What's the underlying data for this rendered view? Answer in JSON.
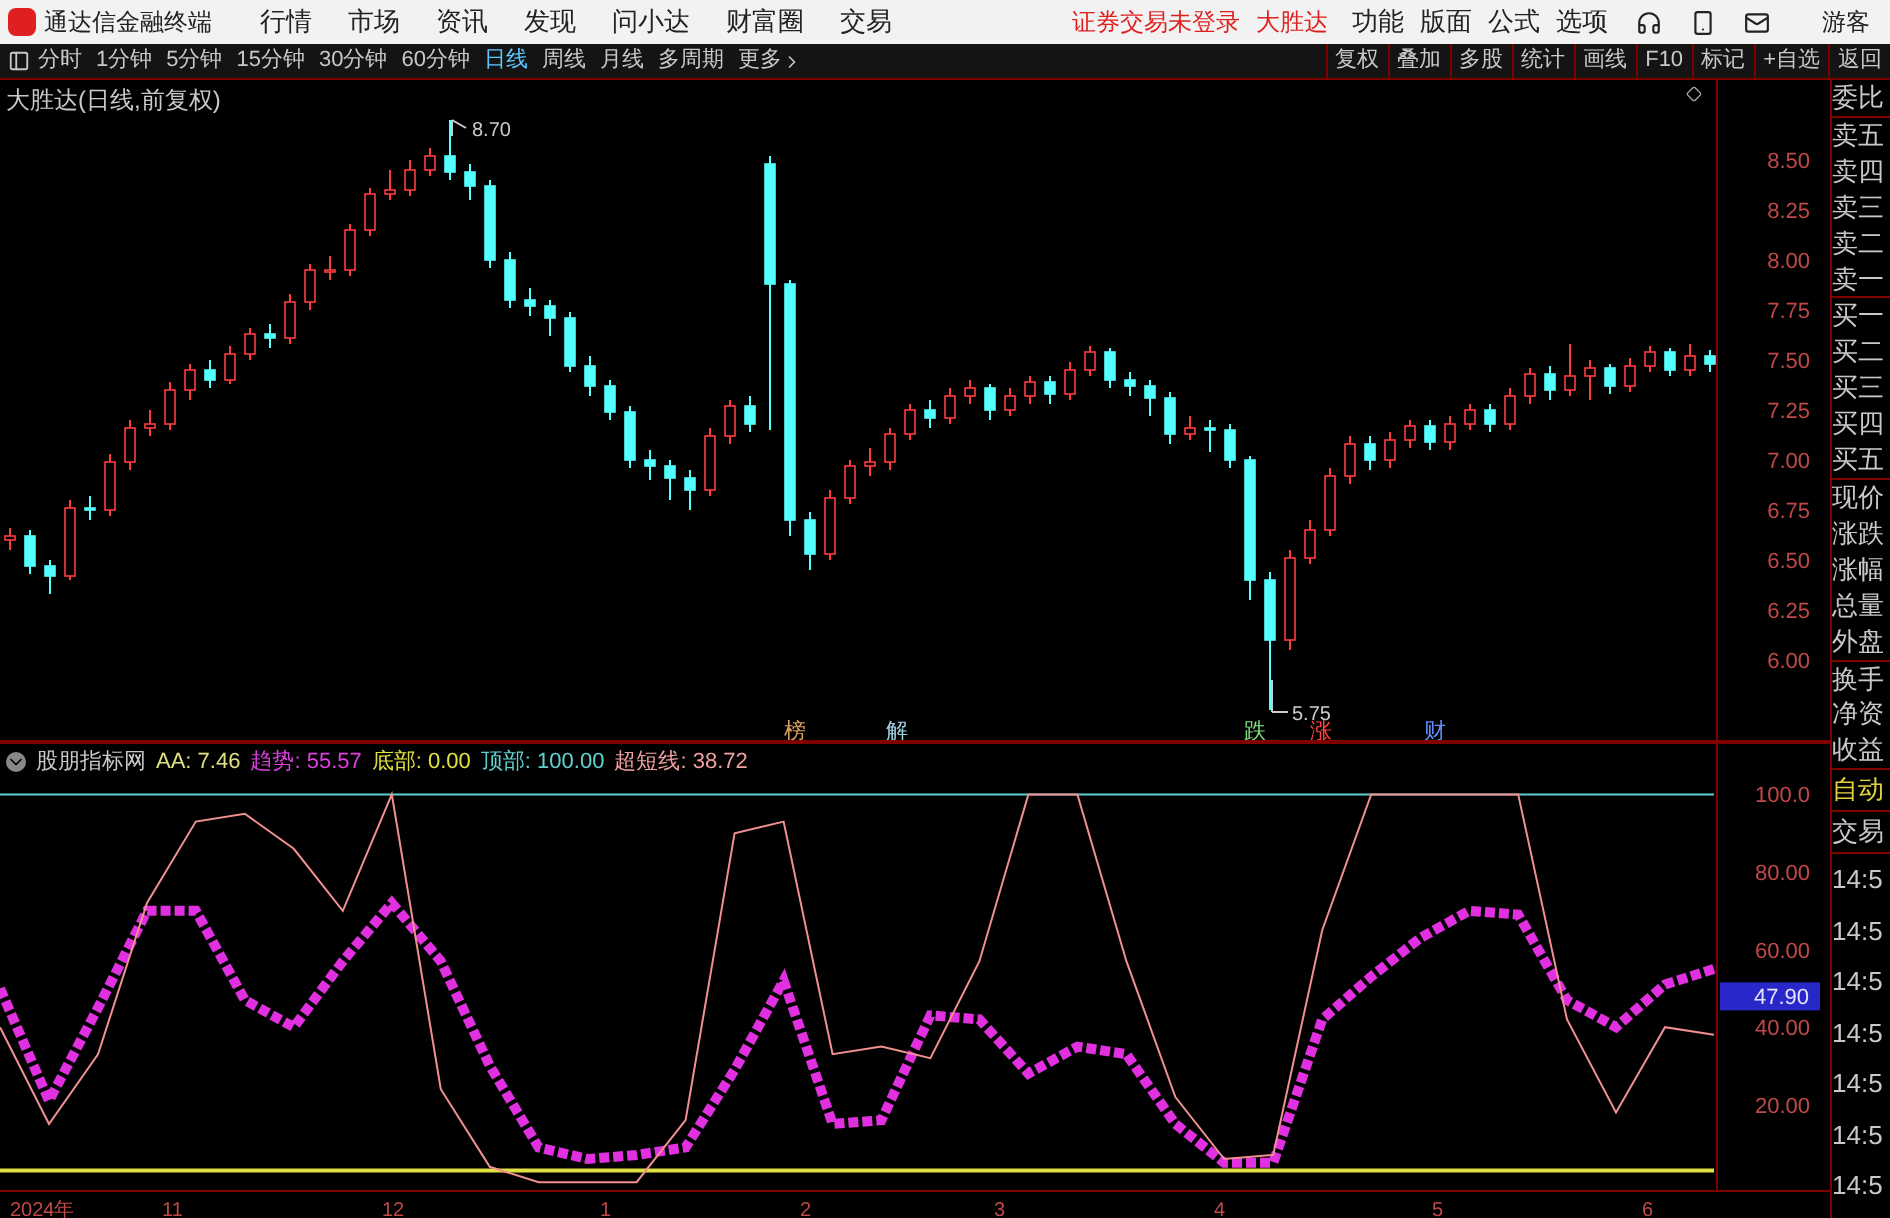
{
  "app": {
    "title": "通达信金融终端"
  },
  "menu": [
    "行情",
    "市场",
    "资讯",
    "发现",
    "问小达",
    "财富圈",
    "交易"
  ],
  "notices": [
    "证券交易未登录",
    "大胜达"
  ],
  "tools": [
    "功能",
    "版面",
    "公式",
    "选项"
  ],
  "user": "游客",
  "periods": [
    {
      "label": "分时",
      "selected": false
    },
    {
      "label": "1分钟",
      "selected": false
    },
    {
      "label": "5分钟",
      "selected": false
    },
    {
      "label": "15分钟",
      "selected": false
    },
    {
      "label": "30分钟",
      "selected": false
    },
    {
      "label": "60分钟",
      "selected": false
    },
    {
      "label": "日线",
      "selected": true
    },
    {
      "label": "周线",
      "selected": false
    },
    {
      "label": "月线",
      "selected": false
    },
    {
      "label": "多周期",
      "selected": false
    },
    {
      "label": "更多",
      "selected": false
    }
  ],
  "actions": [
    "复权",
    "叠加",
    "多股",
    "统计",
    "画线",
    "F10",
    "标记",
    "+自选",
    "返回"
  ],
  "chart": {
    "title": "大胜达(日线,前复权)",
    "high_label": "8.70",
    "low_label": "5.75",
    "chart_data": {
      "type": "candlestick",
      "ylim": [
        5.6,
        8.9
      ],
      "yticks": [
        {
          "value": 8.5,
          "label": "8.50"
        },
        {
          "value": 8.25,
          "label": "8.25"
        },
        {
          "value": 8,
          "label": "8.00"
        },
        {
          "value": 7.75,
          "label": "7.75"
        },
        {
          "value": 7.5,
          "label": "7.50"
        },
        {
          "value": 7.25,
          "label": "7.25"
        },
        {
          "value": 7,
          "label": "7.00"
        },
        {
          "value": 6.75,
          "label": "6.75"
        },
        {
          "value": 6.5,
          "label": "6.50"
        },
        {
          "value": 6.25,
          "label": "6.25"
        },
        {
          "value": 6,
          "label": "6.00"
        }
      ],
      "ohlc": [
        [
          6.6,
          6.66,
          6.55,
          6.62
        ],
        [
          6.62,
          6.65,
          6.43,
          6.47
        ],
        [
          6.47,
          6.5,
          6.33,
          6.42
        ],
        [
          6.42,
          6.8,
          6.4,
          6.76
        ],
        [
          6.76,
          6.82,
          6.7,
          6.75
        ],
        [
          6.75,
          7.03,
          6.72,
          6.99
        ],
        [
          6.99,
          7.2,
          6.95,
          7.16
        ],
        [
          7.16,
          7.25,
          7.12,
          7.18
        ],
        [
          7.18,
          7.39,
          7.15,
          7.35
        ],
        [
          7.35,
          7.48,
          7.3,
          7.45
        ],
        [
          7.45,
          7.5,
          7.36,
          7.4
        ],
        [
          7.4,
          7.57,
          7.38,
          7.53
        ],
        [
          7.53,
          7.66,
          7.5,
          7.63
        ],
        [
          7.63,
          7.68,
          7.56,
          7.61
        ],
        [
          7.61,
          7.83,
          7.58,
          7.79
        ],
        [
          7.79,
          7.98,
          7.75,
          7.95
        ],
        [
          7.95,
          8.02,
          7.9,
          7.95
        ],
        [
          7.95,
          8.18,
          7.92,
          8.15
        ],
        [
          8.15,
          8.36,
          8.12,
          8.33
        ],
        [
          8.33,
          8.45,
          8.3,
          8.35
        ],
        [
          8.35,
          8.5,
          8.32,
          8.45
        ],
        [
          8.45,
          8.56,
          8.42,
          8.52
        ],
        [
          8.52,
          8.7,
          8.4,
          8.44
        ],
        [
          8.44,
          8.48,
          8.3,
          8.37
        ],
        [
          8.37,
          8.4,
          7.96,
          8.0
        ],
        [
          8.0,
          8.04,
          7.76,
          7.8
        ],
        [
          7.8,
          7.86,
          7.72,
          7.77
        ],
        [
          7.77,
          7.8,
          7.62,
          7.71
        ],
        [
          7.71,
          7.74,
          7.44,
          7.47
        ],
        [
          7.47,
          7.52,
          7.32,
          7.37
        ],
        [
          7.37,
          7.4,
          7.2,
          7.24
        ],
        [
          7.24,
          7.27,
          6.96,
          7.0
        ],
        [
          7.0,
          7.05,
          6.9,
          6.97
        ],
        [
          6.97,
          7.0,
          6.8,
          6.91
        ],
        [
          6.91,
          6.95,
          6.75,
          6.85
        ],
        [
          6.85,
          7.16,
          6.82,
          7.12
        ],
        [
          7.12,
          7.3,
          7.08,
          7.27
        ],
        [
          7.27,
          7.32,
          7.14,
          7.18
        ],
        [
          8.48,
          8.52,
          7.15,
          7.88
        ],
        [
          7.88,
          7.9,
          6.62,
          6.7
        ],
        [
          6.7,
          6.74,
          6.45,
          6.53
        ],
        [
          6.53,
          6.85,
          6.5,
          6.81
        ],
        [
          6.81,
          7.0,
          6.78,
          6.97
        ],
        [
          6.97,
          7.06,
          6.92,
          6.99
        ],
        [
          6.99,
          7.16,
          6.95,
          7.13
        ],
        [
          7.13,
          7.28,
          7.1,
          7.25
        ],
        [
          7.25,
          7.3,
          7.16,
          7.21
        ],
        [
          7.21,
          7.36,
          7.18,
          7.32
        ],
        [
          7.32,
          7.4,
          7.28,
          7.36
        ],
        [
          7.36,
          7.38,
          7.2,
          7.25
        ],
        [
          7.25,
          7.36,
          7.22,
          7.32
        ],
        [
          7.32,
          7.42,
          7.28,
          7.39
        ],
        [
          7.39,
          7.42,
          7.28,
          7.33
        ],
        [
          7.33,
          7.49,
          7.3,
          7.45
        ],
        [
          7.45,
          7.57,
          7.42,
          7.54
        ],
        [
          7.54,
          7.56,
          7.36,
          7.4
        ],
        [
          7.4,
          7.44,
          7.32,
          7.37
        ],
        [
          7.37,
          7.4,
          7.22,
          7.31
        ],
        [
          7.31,
          7.34,
          7.08,
          7.13
        ],
        [
          7.13,
          7.22,
          7.1,
          7.16
        ],
        [
          7.16,
          7.2,
          7.04,
          7.15
        ],
        [
          7.15,
          7.18,
          6.96,
          7.0
        ],
        [
          7.0,
          7.02,
          6.3,
          6.4
        ],
        [
          6.4,
          6.44,
          5.75,
          6.1
        ],
        [
          6.1,
          6.55,
          6.05,
          6.51
        ],
        [
          6.51,
          6.7,
          6.48,
          6.65
        ],
        [
          6.65,
          6.96,
          6.62,
          6.92
        ],
        [
          6.92,
          7.12,
          6.88,
          7.08
        ],
        [
          7.08,
          7.12,
          6.95,
          7.0
        ],
        [
          7.0,
          7.14,
          6.96,
          7.1
        ],
        [
          7.1,
          7.2,
          7.06,
          7.17
        ],
        [
          7.17,
          7.2,
          7.05,
          7.09
        ],
        [
          7.09,
          7.22,
          7.05,
          7.18
        ],
        [
          7.18,
          7.28,
          7.15,
          7.25
        ],
        [
          7.25,
          7.28,
          7.14,
          7.18
        ],
        [
          7.18,
          7.36,
          7.15,
          7.32
        ],
        [
          7.32,
          7.46,
          7.28,
          7.43
        ],
        [
          7.43,
          7.47,
          7.3,
          7.35
        ],
        [
          7.35,
          7.58,
          7.32,
          7.42
        ],
        [
          7.42,
          7.5,
          7.3,
          7.46
        ],
        [
          7.46,
          7.48,
          7.33,
          7.37
        ],
        [
          7.37,
          7.51,
          7.34,
          7.47
        ],
        [
          7.47,
          7.57,
          7.44,
          7.54
        ],
        [
          7.54,
          7.56,
          7.42,
          7.45
        ],
        [
          7.45,
          7.58,
          7.42,
          7.52
        ],
        [
          7.52,
          7.55,
          7.44,
          7.48
        ]
      ]
    },
    "tags": [
      {
        "text": "榜",
        "color": "#e0a060"
      },
      {
        "text": "解",
        "color": "#a0d0e0"
      },
      {
        "text": "跌",
        "color": "#80e080"
      },
      {
        "text": "涨",
        "color": "#ff4040"
      },
      {
        "text": "财",
        "color": "#6090ff"
      }
    ]
  },
  "indicator": {
    "name": "股朋指标网",
    "values": [
      {
        "label": "AA:",
        "value": "7.46",
        "color": "#e0e080"
      },
      {
        "label": "趋势:",
        "value": "55.57",
        "color": "#e040e0"
      },
      {
        "label": "底部:",
        "value": "0.00",
        "color": "#e0e040"
      },
      {
        "label": "顶部:",
        "value": "100.00",
        "color": "#60d0d0"
      },
      {
        "label": "超短线:",
        "value": "38.72",
        "color": "#f0a0a0"
      }
    ],
    "chart_data": {
      "type": "line",
      "ylim": [
        -2,
        113
      ],
      "yticks": [
        {
          "value": 100,
          "label": "100.0"
        },
        {
          "value": 80,
          "label": "80.00"
        },
        {
          "value": 60,
          "label": "60.00"
        },
        {
          "value": 40,
          "label": "40.00"
        },
        {
          "value": 20,
          "label": "20.00"
        }
      ],
      "series": [
        {
          "color": "#f09090",
          "values": [
            40,
            15,
            33,
            72,
            93,
            95,
            86,
            70,
            100,
            24,
            4,
            0,
            0,
            0,
            16,
            90,
            93,
            33,
            35,
            32,
            57,
            100,
            100,
            57,
            22,
            6,
            7,
            65,
            100,
            100,
            100,
            100,
            42,
            18,
            40,
            38
          ]
        },
        {
          "color": "#e030e0",
          "line_style": "dashed",
          "values": [
            50,
            21,
            45,
            70,
            70,
            47,
            40,
            57,
            72,
            57,
            30,
            9,
            6,
            7,
            9,
            29,
            52,
            15,
            16,
            43,
            42,
            28,
            35,
            33,
            15,
            5,
            5,
            42,
            53,
            63,
            70,
            69,
            47,
            40,
            51,
            55
          ]
        },
        {
          "color": "#60d0d0",
          "values": [
            100,
            100,
            100,
            100,
            100,
            100,
            100,
            100,
            100,
            100,
            100,
            100,
            100,
            100,
            100,
            100,
            100,
            100,
            100,
            100,
            100,
            100,
            100,
            100,
            100,
            100,
            100,
            100,
            100,
            100,
            100,
            100,
            100,
            100,
            100,
            100
          ]
        },
        {
          "color": "#e0e040",
          "values": [
            3,
            3,
            3,
            3,
            3,
            3,
            3,
            3,
            3,
            3,
            3,
            3,
            3,
            3,
            3,
            3,
            3,
            3,
            3,
            3,
            3,
            3,
            3,
            3,
            3,
            3,
            3,
            3,
            3,
            3,
            3,
            3,
            3,
            3,
            3,
            3
          ]
        }
      ]
    },
    "current": "47.90"
  },
  "date_axis": [
    "2024年",
    "11",
    "12",
    "1",
    "2",
    "3",
    "4",
    "5",
    "6"
  ],
  "quote_panel": {
    "labels": [
      "委比",
      "卖五",
      "卖四",
      "卖三",
      "卖二",
      "卖一",
      "买一",
      "买二",
      "买三",
      "买四",
      "买五",
      "现价",
      "涨跌",
      "涨幅",
      "总量",
      "外盘",
      "换手",
      "净资",
      "收益"
    ],
    "auto": "自动",
    "trade": "交易",
    "times": [
      "14:5",
      "14:5",
      "14:5",
      "14:5",
      "14:5",
      "14:5",
      "14:5"
    ]
  }
}
